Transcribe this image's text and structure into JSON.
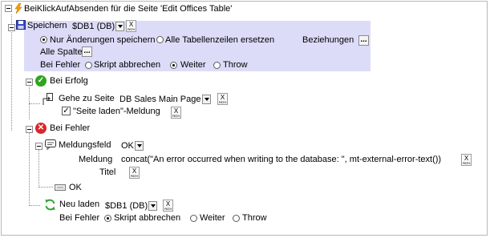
{
  "colors": {
    "highlight": "#dcdcf9",
    "success_icon": "#2ea51e",
    "error_icon": "#d9262a",
    "lightning": "#f2a100",
    "disk": "#3a49c4",
    "reload": "#2da62d"
  },
  "root": {
    "title": "BeiKlickAufAbsenden für die Seite 'Edit Offices Table'",
    "icon": "lightning-icon"
  },
  "speichern": {
    "label": "Speichern",
    "source": "$DB1 (DB)",
    "radio_changes_only": "Nur Änderungen speichern",
    "radio_replace_all": "Alle Tabellenzeilen ersetzen",
    "relations_label": "Beziehungen",
    "all_columns_label": "Alle Spalten",
    "on_error_label": "Bei Fehler",
    "on_error_options": [
      "Skript abbrechen",
      "Weiter",
      "Throw"
    ],
    "on_error_selected": "Weiter",
    "save_mode_selected": "Nur Änderungen speichern"
  },
  "on_success": {
    "label": "Bei Erfolg",
    "goto_label": "Gehe zu Seite",
    "goto_page": "DB Sales Main Page",
    "load_message_label": "\"Seite laden\"-Meldung",
    "load_message_checked": true
  },
  "on_error": {
    "label": "Bei Fehler",
    "message_box_label": "Meldungsfeld",
    "message_box_value": "OK",
    "message_label": "Meldung",
    "message_value": "concat(\"An error occurred when writing to the database: \", mt-external-error-text())",
    "title_label": "Titel",
    "ok_label": "OK",
    "reload_label": "Neu laden",
    "reload_source": "$DB1 (DB)",
    "reload_on_error_label": "Bei Fehler",
    "reload_on_error_options": [
      "Skript abbrechen",
      "Weiter",
      "Throw"
    ],
    "reload_on_error_selected": "Skript abbrechen"
  },
  "xpath_button": {
    "x": "X",
    "path": "PATH"
  },
  "ellipsis": "..."
}
